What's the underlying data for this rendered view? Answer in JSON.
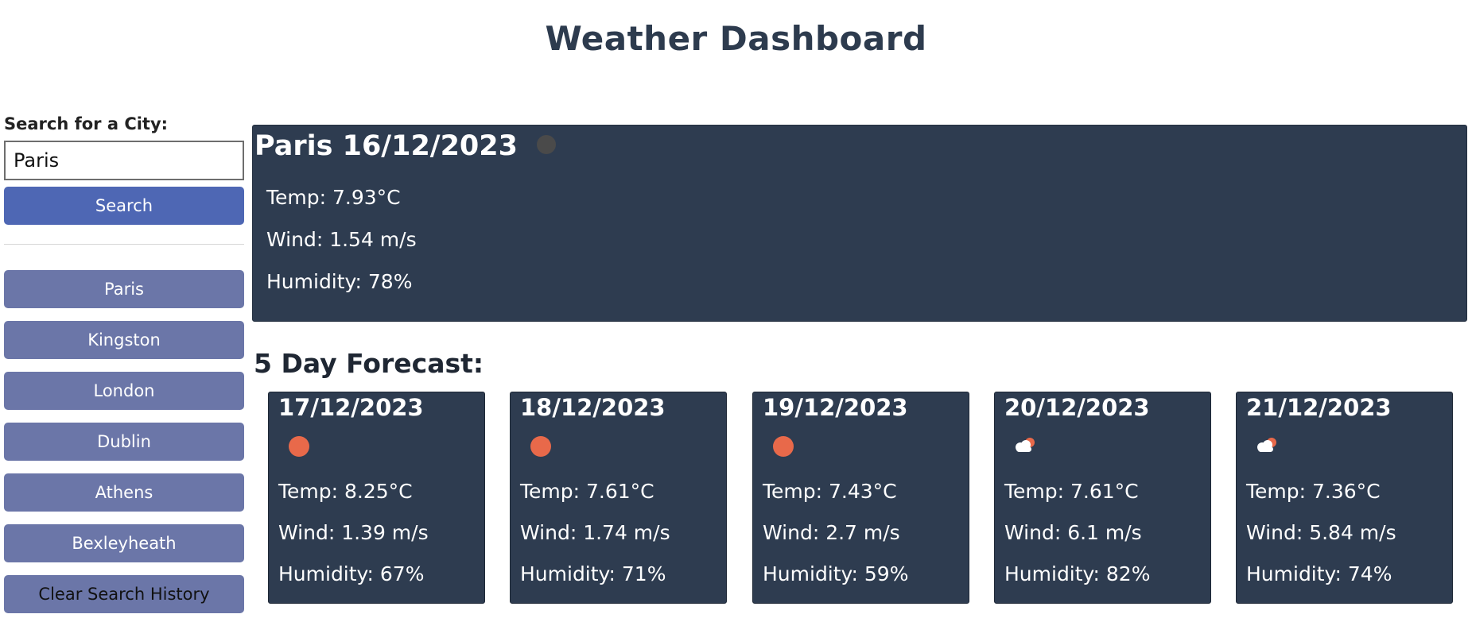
{
  "header": {
    "title": "Weather Dashboard"
  },
  "sidebar": {
    "search_label": "Search for a City:",
    "search_value": "Paris",
    "search_button": "Search",
    "history": [
      "Paris",
      "Kingston",
      "London",
      "Dublin",
      "Athens",
      "Bexleyheath"
    ],
    "clear_button": "Clear Search History"
  },
  "current": {
    "heading": "Paris 16/12/2023",
    "icon": "weather-icon-dark-circle",
    "temp": "Temp: 7.93°C",
    "wind": "Wind: 1.54 m/s",
    "humidity": "Humidity: 78%"
  },
  "forecast": {
    "heading": "5 Day Forecast:",
    "days": [
      {
        "date": "17/12/2023",
        "icon": "sun-icon",
        "temp": "Temp: 8.25°C",
        "wind": "Wind: 1.39 m/s",
        "humidity": "Humidity: 67%"
      },
      {
        "date": "18/12/2023",
        "icon": "sun-icon",
        "temp": "Temp: 7.61°C",
        "wind": "Wind: 1.74 m/s",
        "humidity": "Humidity: 71%"
      },
      {
        "date": "19/12/2023",
        "icon": "sun-icon",
        "temp": "Temp: 7.43°C",
        "wind": "Wind: 2.7 m/s",
        "humidity": "Humidity: 59%"
      },
      {
        "date": "20/12/2023",
        "icon": "cloud-sun-icon",
        "temp": "Temp: 7.61°C",
        "wind": "Wind: 6.1 m/s",
        "humidity": "Humidity: 82%"
      },
      {
        "date": "21/12/2023",
        "icon": "cloud-sun-icon",
        "temp": "Temp: 7.36°C",
        "wind": "Wind: 5.84 m/s",
        "humidity": "Humidity: 74%"
      }
    ]
  },
  "colors": {
    "card_bg": "#2e3c50",
    "search_button": "#4e67b4",
    "history_button": "#6b76a8",
    "sun": "#e8694a"
  }
}
